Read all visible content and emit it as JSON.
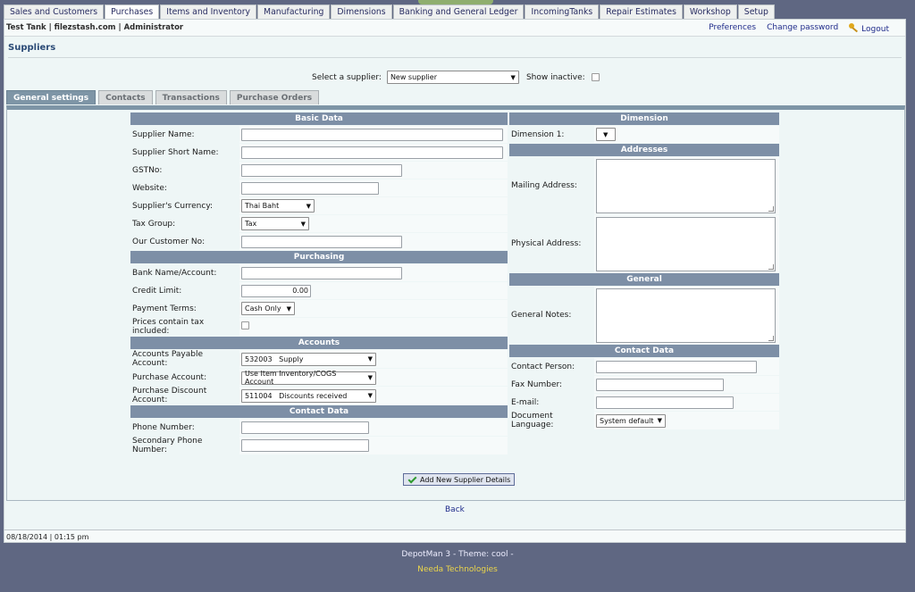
{
  "menu": [
    {
      "label": "Sales and Customers",
      "active": false
    },
    {
      "label": "Purchases",
      "active": true
    },
    {
      "label": "Items and Inventory",
      "active": false
    },
    {
      "label": "Manufacturing",
      "active": false
    },
    {
      "label": "Dimensions",
      "active": false
    },
    {
      "label": "Banking and General Ledger",
      "active": false
    },
    {
      "label": "IncomingTanks",
      "active": false
    },
    {
      "label": "Repair Estimates",
      "active": false
    },
    {
      "label": "Workshop",
      "active": false
    },
    {
      "label": "Setup",
      "active": false
    }
  ],
  "userbar": {
    "company": "Test Tank | filezstash.com | Administrator",
    "preferences": "Preferences",
    "change_password": "Change password",
    "logout": "Logout"
  },
  "page_title": "Suppliers",
  "selector": {
    "label": "Select a supplier:",
    "value": "New supplier",
    "show_inactive_label": "Show inactive:"
  },
  "tabs": [
    "General settings",
    "Contacts",
    "Transactions",
    "Purchase Orders"
  ],
  "left": {
    "basic_header": "Basic Data",
    "supplier_name": "Supplier Name:",
    "supplier_short_name": "Supplier Short Name:",
    "gstno": "GSTNo:",
    "website": "Website:",
    "currency": "Supplier's Currency:",
    "currency_value": "Thai Baht",
    "tax_group": "Tax Group:",
    "tax_group_value": "Tax",
    "our_customer_no": "Our Customer No:",
    "purchasing_header": "Purchasing",
    "bank": "Bank Name/Account:",
    "credit_limit": "Credit Limit:",
    "credit_limit_value": "0.00",
    "payment_terms": "Payment Terms:",
    "payment_terms_value": "Cash Only",
    "prices_tax": "Prices contain tax included:",
    "accounts_header": "Accounts",
    "ap_account": "Accounts Payable Account:",
    "ap_account_value": "532003   Supply",
    "purchase_account": "Purchase Account:",
    "purchase_account_value": "Use Item Inventory/COGS Account",
    "discount_account": "Purchase Discount Account:",
    "discount_account_value": "511004   Discounts received",
    "contact_header": "Contact Data",
    "phone": "Phone Number:",
    "phone2": "Secondary Phone Number:"
  },
  "right": {
    "dimension_header": "Dimension",
    "dimension1": "Dimension 1:",
    "addresses_header": "Addresses",
    "mailing": "Mailing Address:",
    "physical": "Physical Address:",
    "general_header": "General",
    "notes": "General Notes:",
    "contact_header": "Contact Data",
    "contact_person": "Contact Person:",
    "fax": "Fax Number:",
    "email": "E-mail:",
    "language": "Document Language:",
    "language_value": "System default"
  },
  "add_button": "Add New Supplier Details",
  "back": "Back",
  "status": "08/18/2014 | 01:15 pm",
  "footer": {
    "line1": "DepotMan 3 - Theme: cool -",
    "line2": "Needa Technologies"
  }
}
